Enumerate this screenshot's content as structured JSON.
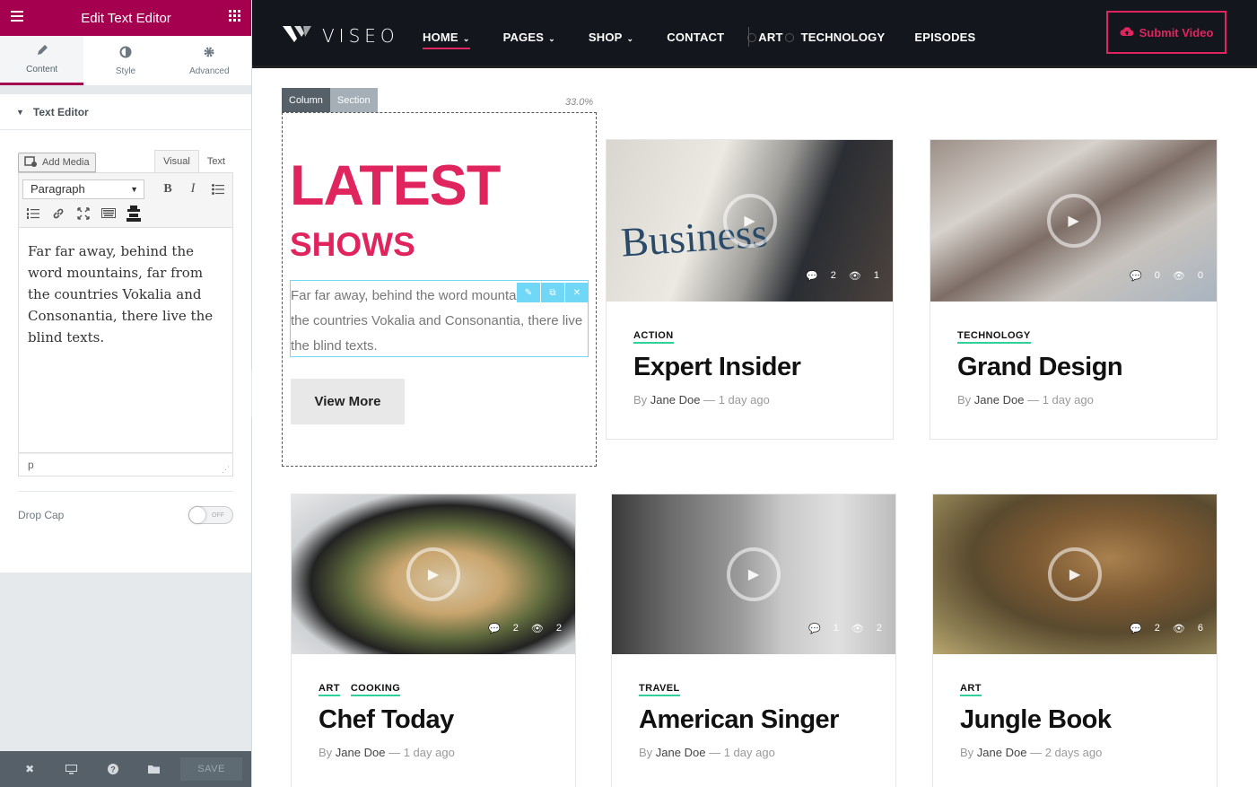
{
  "panel": {
    "title": "Edit Text Editor",
    "tabs": [
      {
        "label": "Content",
        "icon": "pencil-icon"
      },
      {
        "label": "Style",
        "icon": "contrast-icon"
      },
      {
        "label": "Advanced",
        "icon": "gear-icon"
      }
    ],
    "section_title": "Text Editor",
    "add_media_label": "Add Media",
    "editor_tabs": {
      "visual": "Visual",
      "text": "Text"
    },
    "format_select": "Paragraph",
    "editor_content": "Far far away, behind the word mountains, far from the countries Vokalia and Consonantia, there live the blind texts.",
    "path_label": "p",
    "drop_cap_label": "Drop Cap",
    "drop_cap_state": "OFF",
    "save_label": "SAVE"
  },
  "site": {
    "logo": "VISEO",
    "menu": [
      {
        "label": "HOME",
        "dropdown": true,
        "active": true
      },
      {
        "label": "PAGES",
        "dropdown": true
      },
      {
        "label": "SHOP",
        "dropdown": true
      },
      {
        "label": "CONTACT",
        "dropdown": false
      },
      {
        "label": "ART",
        "dropdown": false
      },
      {
        "label": "TECHNOLOGY",
        "dropdown": false
      },
      {
        "label": "EPISODES",
        "dropdown": false
      }
    ],
    "submit_label": "Submit Video",
    "accent": "#e0245e",
    "column_tab": "Column",
    "section_tab": "Section",
    "column_width": "33.0%",
    "heading_1": "LATEST",
    "heading_2": "SHOWS",
    "intro_text": "Far far away, behind the word mountains, far from the countries Vokalia and Consonantia, there live the blind texts.",
    "view_more": "View More",
    "cards": [
      {
        "cats": [
          "ACTION"
        ],
        "title": "Expert Insider",
        "author": "Jane Doe",
        "time": "1 day ago",
        "comments": "2",
        "views": "1",
        "image_text": "Business"
      },
      {
        "cats": [
          "TECHNOLOGY"
        ],
        "title": "Grand Design",
        "author": "Jane Doe",
        "time": "1 day ago",
        "comments": "0",
        "views": "0"
      },
      {
        "cats": [
          "ART",
          "COOKING"
        ],
        "title": "Chef Today",
        "author": "Jane Doe",
        "time": "1 day ago",
        "comments": "2",
        "views": "2"
      },
      {
        "cats": [
          "TRAVEL"
        ],
        "title": "American Singer",
        "author": "Jane Doe",
        "time": "1 day ago",
        "comments": "1",
        "views": "2"
      },
      {
        "cats": [
          "ART"
        ],
        "title": "Jungle Book",
        "author": "Jane Doe",
        "time": "2 days ago",
        "comments": "2",
        "views": "6"
      }
    ],
    "by_label": "By",
    "meta_sep": "—"
  }
}
